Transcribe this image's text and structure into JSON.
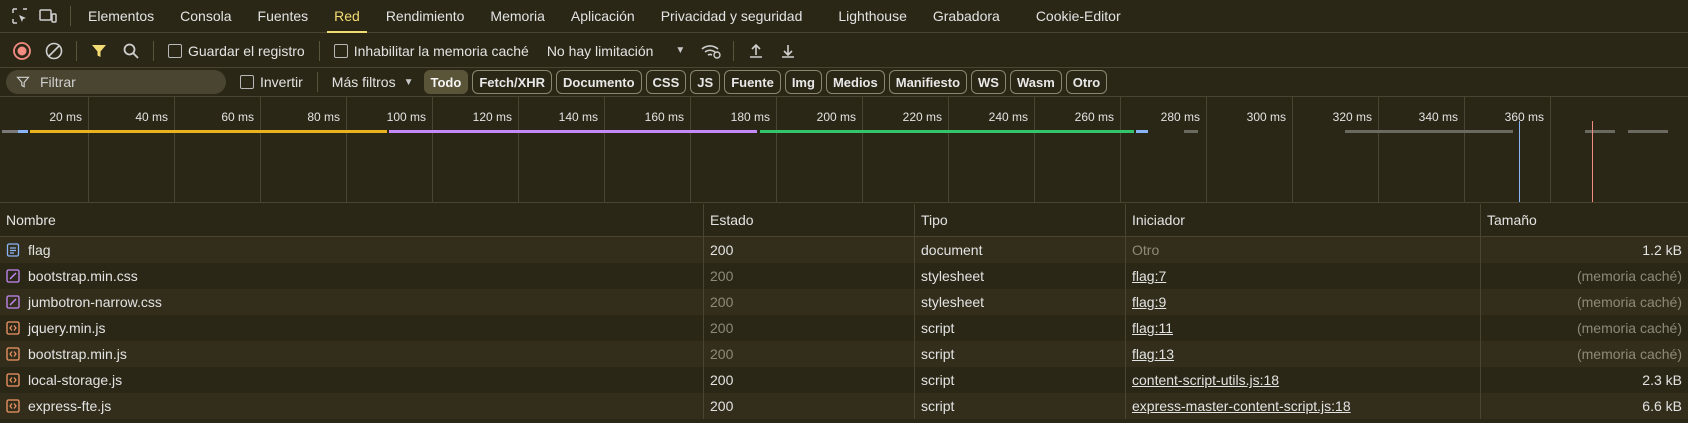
{
  "tabs": [
    {
      "label": "Elementos",
      "name": "tab-elements",
      "active": false
    },
    {
      "label": "Consola",
      "name": "tab-console",
      "active": false
    },
    {
      "label": "Fuentes",
      "name": "tab-sources",
      "active": false
    },
    {
      "label": "Red",
      "name": "tab-network",
      "active": true
    },
    {
      "label": "Rendimiento",
      "name": "tab-performance",
      "active": false
    },
    {
      "label": "Memoria",
      "name": "tab-memory",
      "active": false
    },
    {
      "label": "Aplicación",
      "name": "tab-application",
      "active": false
    },
    {
      "label": "Privacidad y seguridad",
      "name": "tab-privacy",
      "active": false
    },
    {
      "label": "Lighthouse",
      "name": "tab-lighthouse",
      "active": false
    },
    {
      "label": "Grabadora",
      "name": "tab-recorder",
      "active": false
    },
    {
      "label": "Cookie-Editor",
      "name": "tab-cookie-editor",
      "active": false
    }
  ],
  "toolbar": {
    "preserve_log": "Guardar el registro",
    "disable_cache": "Inhabilitar la memoria caché",
    "throttling": "No hay limitación"
  },
  "filters": {
    "placeholder": "Filtrar",
    "invert": "Invertir",
    "more_filters": "Más filtros",
    "types": [
      {
        "label": "Todo",
        "active": true
      },
      {
        "label": "Fetch/XHR",
        "active": false
      },
      {
        "label": "Documento",
        "active": false
      },
      {
        "label": "CSS",
        "active": false
      },
      {
        "label": "JS",
        "active": false
      },
      {
        "label": "Fuente",
        "active": false
      },
      {
        "label": "Img",
        "active": false
      },
      {
        "label": "Medios",
        "active": false
      },
      {
        "label": "Manifiesto",
        "active": false
      },
      {
        "label": "WS",
        "active": false
      },
      {
        "label": "Wasm",
        "active": false
      },
      {
        "label": "Otro",
        "active": false
      }
    ]
  },
  "overview": {
    "ticks": [
      "20 ms",
      "40 ms",
      "60 ms",
      "80 ms",
      "100 ms",
      "120 ms",
      "140 ms",
      "160 ms",
      "180 ms",
      "200 ms",
      "220 ms",
      "240 ms",
      "260 ms",
      "280 ms",
      "300 ms",
      "320 ms",
      "340 ms",
      "360 ms"
    ]
  },
  "table": {
    "headers": {
      "name": "Nombre",
      "status": "Estado",
      "type": "Tipo",
      "initiator": "Iniciador",
      "size": "Tamaño"
    },
    "rows": [
      {
        "name": "flag",
        "status": "200",
        "type": "document",
        "initiator": "Otro",
        "size": "1.2 kB",
        "kind": "doc",
        "cached": false,
        "link": false
      },
      {
        "name": "bootstrap.min.css",
        "status": "200",
        "type": "stylesheet",
        "initiator": "flag:7",
        "size": "(memoria caché)",
        "kind": "css",
        "cached": true,
        "link": true
      },
      {
        "name": "jumbotron-narrow.css",
        "status": "200",
        "type": "stylesheet",
        "initiator": "flag:9",
        "size": "(memoria caché)",
        "kind": "css",
        "cached": true,
        "link": true
      },
      {
        "name": "jquery.min.js",
        "status": "200",
        "type": "script",
        "initiator": "flag:11",
        "size": "(memoria caché)",
        "kind": "js",
        "cached": true,
        "link": true
      },
      {
        "name": "bootstrap.min.js",
        "status": "200",
        "type": "script",
        "initiator": "flag:13",
        "size": "(memoria caché)",
        "kind": "js",
        "cached": true,
        "link": true
      },
      {
        "name": "local-storage.js",
        "status": "200",
        "type": "script",
        "initiator": "content-script-utils.js:18",
        "size": "2.3 kB",
        "kind": "js",
        "cached": false,
        "link": true
      },
      {
        "name": "express-fte.js",
        "status": "200",
        "type": "script",
        "initiator": "express-master-content-script.js:18",
        "size": "6.6 kB",
        "kind": "js",
        "cached": false,
        "link": true
      }
    ]
  },
  "colors": {
    "accent": "#f2dc73",
    "record": "#f28b82",
    "doc": "#8ab4f8",
    "css": "#c58af9",
    "js": "#f29766"
  }
}
